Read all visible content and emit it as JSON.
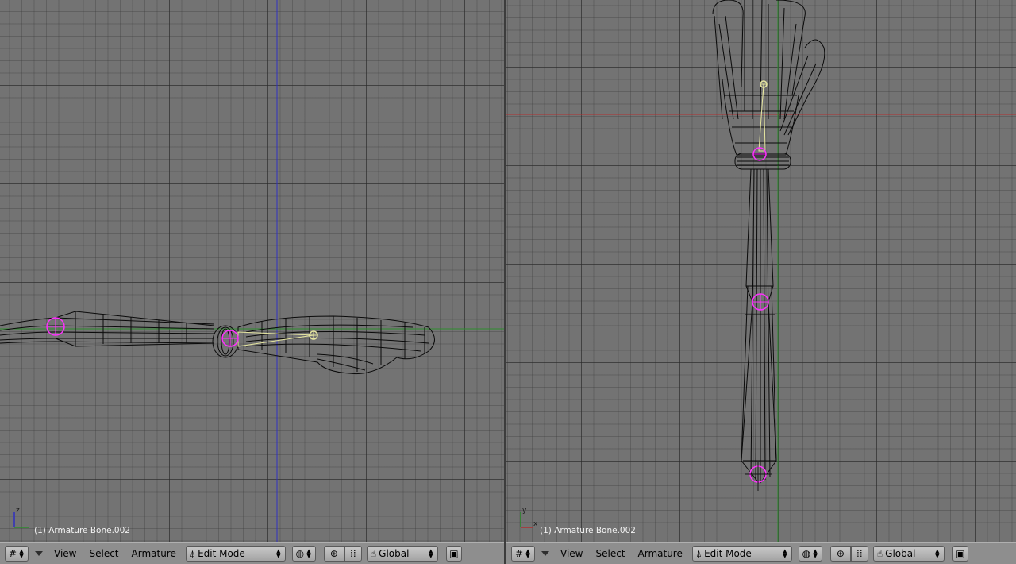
{
  "viewports": {
    "left": {
      "object_label": "(1) Armature Bone.002",
      "axis_vertical": "z",
      "axis_horizontal": ""
    },
    "right": {
      "object_label": "(1) Armature Bone.002",
      "axis_vertical": "y",
      "axis_horizontal": "x"
    }
  },
  "header": {
    "menus": [
      "View",
      "Select",
      "Armature"
    ],
    "mode": "Edit Mode",
    "orientation": "Global"
  },
  "icons": {
    "window_type": "grid-icon",
    "draw_type": "sphere-wire-icon",
    "pivot": "crosshair-icon",
    "manipulator": "manipulator-icon",
    "orientation_hand": "hand-icon",
    "render_preview": "render-icon"
  },
  "colors": {
    "viewport_bg": "#737373",
    "mesh_wire": "#0a0a0a",
    "bone_selected": "#e5e5a0",
    "joint": "#ff30ff",
    "axis_red": "#b03030",
    "axis_green": "#2c8c2c",
    "axis_blue": "#3030c0"
  }
}
